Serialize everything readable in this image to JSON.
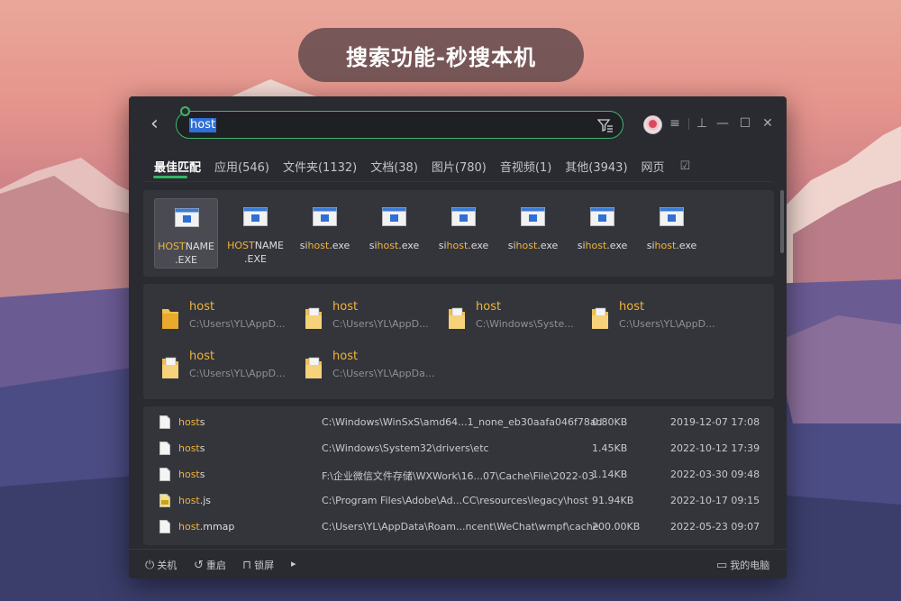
{
  "banner": {
    "text": "搜索功能-秒搜本机"
  },
  "search": {
    "value": "host"
  },
  "window_controls": {
    "menu": "≡",
    "pin": "⊥",
    "minimize": "—",
    "maximize": "☐",
    "close": "✕"
  },
  "tabs": [
    {
      "label": "最佳匹配",
      "active": true
    },
    {
      "label": "应用(546)"
    },
    {
      "label": "文件夹(1132)"
    },
    {
      "label": "文档(38)"
    },
    {
      "label": "图片(780)"
    },
    {
      "label": "音视频(1)"
    },
    {
      "label": "其他(3943)"
    },
    {
      "label": "网页"
    }
  ],
  "apps": [
    {
      "hl": "HOST",
      "rest": "NAME",
      "line2": ".EXE",
      "selected": true
    },
    {
      "hl": "HOST",
      "rest": "NAME",
      "line2": ".EXE"
    },
    {
      "pre": "si",
      "hl": "host",
      "rest": ".exe"
    },
    {
      "pre": "si",
      "hl": "host",
      "rest": ".exe"
    },
    {
      "pre": "si",
      "hl": "host",
      "rest": ".exe"
    },
    {
      "pre": "si",
      "hl": "host",
      "rest": ".exe"
    },
    {
      "pre": "si",
      "hl": "host",
      "rest": ".exe"
    },
    {
      "pre": "si",
      "hl": "host",
      "rest": ".exe"
    }
  ],
  "folders": [
    {
      "name": "host",
      "path": "C:\\Users\\YL\\AppD..."
    },
    {
      "name": "host",
      "path": "C:\\Users\\YL\\AppD..."
    },
    {
      "name": "host",
      "path": "C:\\Windows\\Syste..."
    },
    {
      "name": "host",
      "path": "C:\\Users\\YL\\AppD..."
    },
    {
      "name": "host",
      "path": "C:\\Users\\YL\\AppD..."
    },
    {
      "name": "host",
      "path": "C:\\Users\\YL\\AppDa..."
    }
  ],
  "files": [
    {
      "hl": "host",
      "rest": "s",
      "path": "C:\\Windows\\WinSxS\\amd64...1_none_eb30aafa046f78ad",
      "size": "0.80KB",
      "date": "2019-12-07 17:08"
    },
    {
      "hl": "host",
      "rest": "s",
      "path": "C:\\Windows\\System32\\drivers\\etc",
      "size": "1.45KB",
      "date": "2022-10-12 17:39"
    },
    {
      "hl": "host",
      "rest": "s",
      "path": "F:\\企业微信文件存储\\WXWork\\16...07\\Cache\\File\\2022-03",
      "size": "1.14KB",
      "date": "2022-03-30 09:48"
    },
    {
      "hl": "host",
      "rest": ".js",
      "path": "C:\\Program Files\\Adobe\\Ad...CC\\resources\\legacy\\host",
      "size": "91.94KB",
      "date": "2022-10-17 09:15"
    },
    {
      "hl": "host",
      "rest": ".mmap",
      "path": "C:\\Users\\YL\\AppData\\Roam...ncent\\WeChat\\wmpf\\cache",
      "size": "200.00KB",
      "date": "2022-05-23 09:07"
    }
  ],
  "footer": {
    "shutdown": "关机",
    "restart": "重启",
    "lock": "锁屏",
    "more": "▸",
    "my_computer": "我的电脑"
  }
}
